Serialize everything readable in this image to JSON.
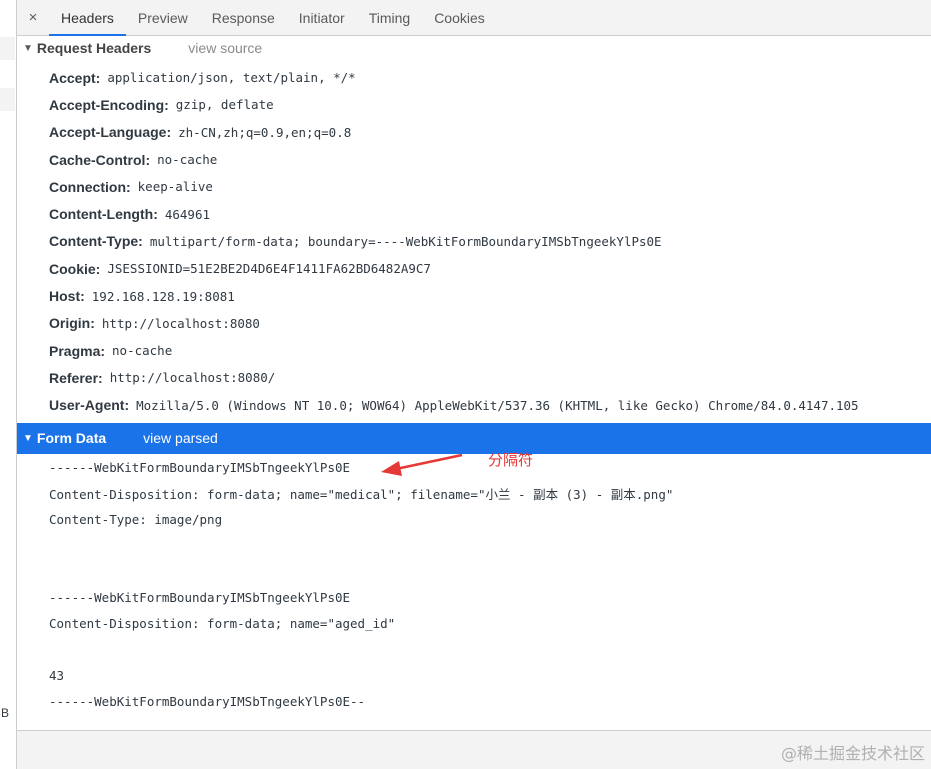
{
  "tabs": {
    "close_symbol": "×",
    "items": [
      "Headers",
      "Preview",
      "Response",
      "Initiator",
      "Timing",
      "Cookies"
    ],
    "active": "Headers"
  },
  "request_headers": {
    "title": "Request Headers",
    "link": "view source",
    "rows": [
      {
        "name": "Accept:",
        "value": "application/json, text/plain, */*"
      },
      {
        "name": "Accept-Encoding:",
        "value": "gzip, deflate"
      },
      {
        "name": "Accept-Language:",
        "value": "zh-CN,zh;q=0.9,en;q=0.8"
      },
      {
        "name": "Cache-Control:",
        "value": "no-cache"
      },
      {
        "name": "Connection:",
        "value": "keep-alive"
      },
      {
        "name": "Content-Length:",
        "value": "464961"
      },
      {
        "name": "Content-Type:",
        "value": "multipart/form-data; boundary=----WebKitFormBoundaryIMSbTngeekYlPs0E"
      },
      {
        "name": "Cookie:",
        "value": "JSESSIONID=51E2BE2D4D6E4F1411FA62BD6482A9C7"
      },
      {
        "name": "Host:",
        "value": "192.168.128.19:8081"
      },
      {
        "name": "Origin:",
        "value": "http://localhost:8080"
      },
      {
        "name": "Pragma:",
        "value": "no-cache"
      },
      {
        "name": "Referer:",
        "value": "http://localhost:8080/"
      },
      {
        "name": "User-Agent:",
        "value": "Mozilla/5.0 (Windows NT 10.0; WOW64) AppleWebKit/537.36 (KHTML, like Gecko) Chrome/84.0.4147.105"
      }
    ]
  },
  "form_data": {
    "title": "Form Data",
    "link": "view parsed",
    "lines": [
      "------WebKitFormBoundaryIMSbTngeekYlPs0E",
      "Content-Disposition: form-data; name=\"medical\"; filename=\"小兰 - 副本 (3) - 副本.png\"",
      "Content-Type: image/png",
      "",
      "",
      "------WebKitFormBoundaryIMSbTngeekYlPs0E",
      "Content-Disposition: form-data; name=\"aged_id\"",
      "",
      "43",
      "------WebKitFormBoundaryIMSbTngeekYlPs0E--"
    ]
  },
  "annotation": {
    "label": "分隔符",
    "color": "#e53935"
  },
  "left_strip": {
    "cut_text": "B"
  },
  "watermark": "@稀土掘金技术社区",
  "colors": {
    "accent": "#1a73e8",
    "tab_bar_bg": "#f3f3f3",
    "text": "#303942"
  }
}
